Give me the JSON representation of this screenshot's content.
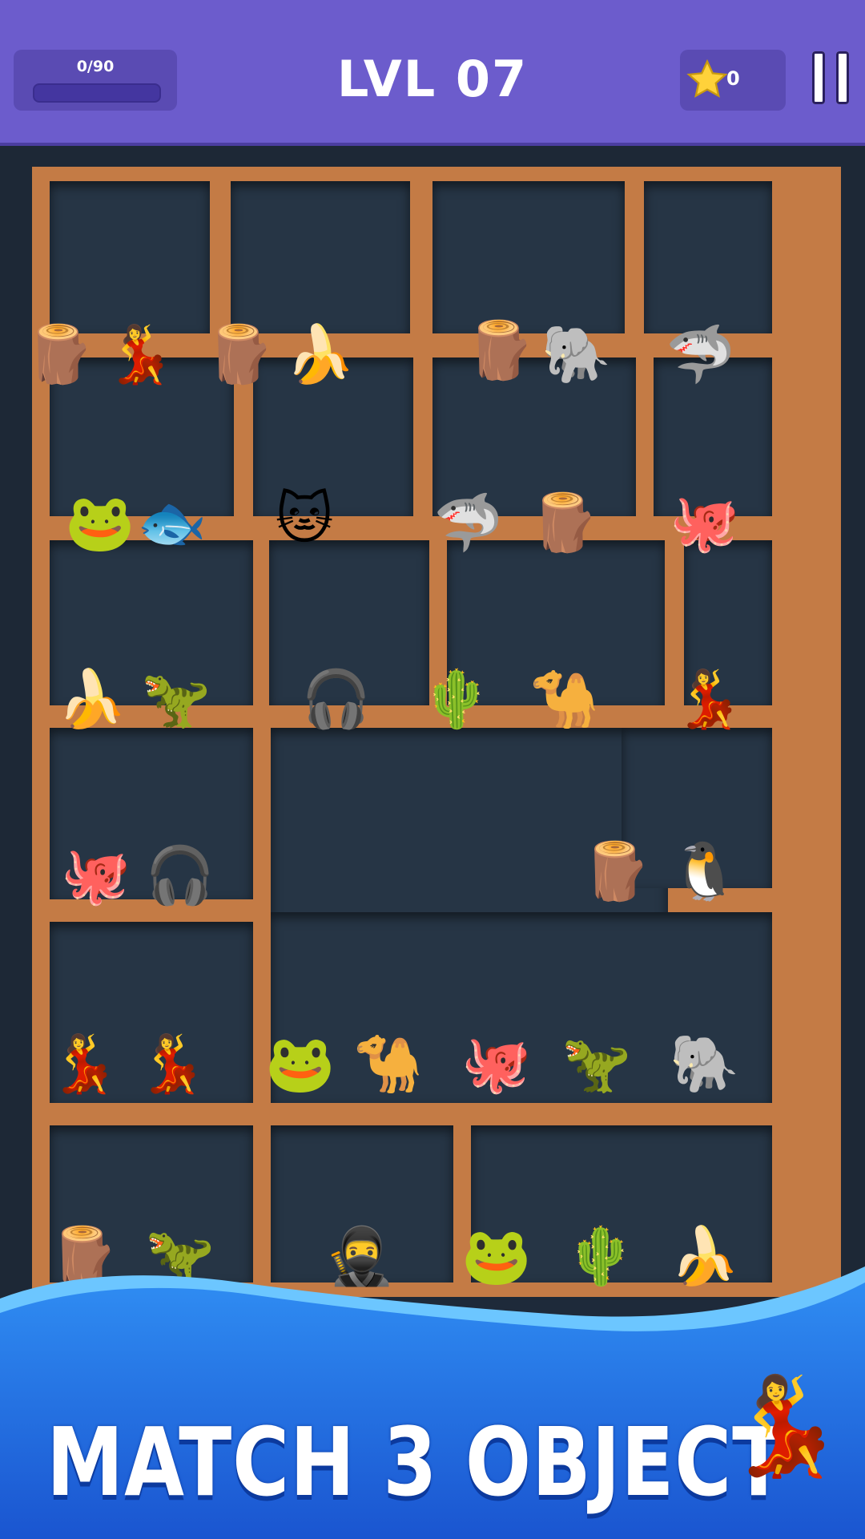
{
  "header": {
    "progress_text": "0/90",
    "progress_fraction": 0,
    "level_label": "LVL  07",
    "stars_count": "0"
  },
  "board": {
    "objects": [
      {
        "name": "wooden-man-icon",
        "glyph": "🪵"
      },
      {
        "name": "ballerina-cup-icon",
        "glyph": "💃"
      },
      {
        "name": "wooden-man-icon",
        "glyph": "🪵"
      },
      {
        "name": "banana-monkey-icon",
        "glyph": "🍌"
      },
      {
        "name": "wood-log-man-icon",
        "glyph": "🪵"
      },
      {
        "name": "green-elephant-sandal-icon",
        "glyph": "🐘"
      },
      {
        "name": "shark-sneakers-icon",
        "glyph": "🦈"
      },
      {
        "name": "frog-tire-icon",
        "glyph": "🐸"
      },
      {
        "name": "green-fish-figure-icon",
        "glyph": "🐟"
      },
      {
        "name": "tiger-cat-icon",
        "glyph": "🐱"
      },
      {
        "name": "shark-sneakers-icon",
        "glyph": "🦈"
      },
      {
        "name": "wooden-man-icon",
        "glyph": "🪵"
      },
      {
        "name": "purple-octopus-icon",
        "glyph": "🐙"
      },
      {
        "name": "banana-monkey-icon",
        "glyph": "🍌"
      },
      {
        "name": "blue-dino-icon",
        "glyph": "🦖"
      },
      {
        "name": "bat-guy-headphones-icon",
        "glyph": "🎧"
      },
      {
        "name": "cactus-capybara-icon",
        "glyph": "🌵"
      },
      {
        "name": "camel-fridge-icon",
        "glyph": "🐪"
      },
      {
        "name": "ballerina-cup-icon",
        "glyph": "💃"
      },
      {
        "name": "purple-octopus-icon",
        "glyph": "🐙"
      },
      {
        "name": "bat-guy-headphones-icon",
        "glyph": "🎧"
      },
      {
        "name": "wooden-man-icon",
        "glyph": "🪵"
      },
      {
        "name": "penguin-bird-icon",
        "glyph": "🐧"
      },
      {
        "name": "ballerina-cup-icon",
        "glyph": "💃"
      },
      {
        "name": "ballerina-cup-icon",
        "glyph": "💃"
      },
      {
        "name": "frog-tire-icon",
        "glyph": "🐸"
      },
      {
        "name": "camel-fridge-icon",
        "glyph": "🐪"
      },
      {
        "name": "purple-octopus-icon",
        "glyph": "🐙"
      },
      {
        "name": "blue-dino-icon",
        "glyph": "🦖"
      },
      {
        "name": "green-elephant-sandal-icon",
        "glyph": "🐘"
      },
      {
        "name": "wooden-man-icon",
        "glyph": "🪵"
      },
      {
        "name": "blue-dino-icon",
        "glyph": "🦖"
      },
      {
        "name": "ninja-coffee-cup-icon",
        "glyph": "🥷"
      },
      {
        "name": "frog-tire-icon",
        "glyph": "🐸"
      },
      {
        "name": "cactus-capybara-icon",
        "glyph": "🌵"
      },
      {
        "name": "banana-monkey-icon",
        "glyph": "🍌"
      }
    ]
  },
  "banner": {
    "text": "MATCH 3 OBJECT",
    "mascot_glyph": "💃"
  },
  "colors": {
    "topbar": "#6c5ccc",
    "shelf_wood": "#c47b45",
    "cell_bg": "#263545",
    "banner_blue": "#1a6ee0",
    "star": "#ffd23a"
  }
}
